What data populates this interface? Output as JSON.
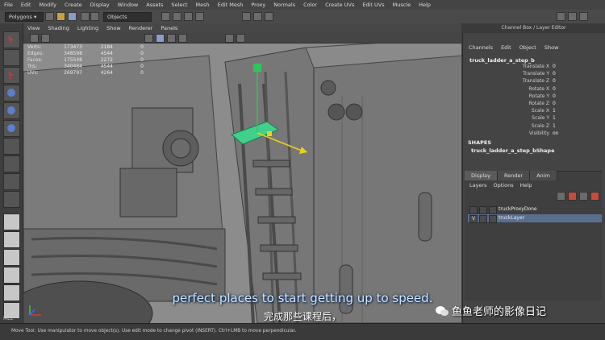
{
  "menu": [
    "File",
    "Edit",
    "Modify",
    "Create",
    "Display",
    "Window",
    "Assets",
    "Select",
    "Mesh",
    "Edit Mesh",
    "Proxy",
    "Normals",
    "Color",
    "Create UVs",
    "Edit UVs",
    "Muscle",
    "Help"
  ],
  "status": {
    "mode": "Polygons",
    "objects_label": "Objects"
  },
  "viewport": {
    "menu": [
      "View",
      "Shading",
      "Lighting",
      "Show",
      "Renderer",
      "Panels"
    ],
    "hud": [
      {
        "label": "Verts:",
        "a": "173473",
        "b": "2184",
        "c": "0"
      },
      {
        "label": "Edges:",
        "a": "348598",
        "b": "4544",
        "c": "0"
      },
      {
        "label": "Faces:",
        "a": "175548",
        "b": "2272",
        "c": "0"
      },
      {
        "label": "Tris:",
        "a": "340484",
        "b": "4544",
        "c": "0"
      },
      {
        "label": "UVs:",
        "a": "269797",
        "b": "4264",
        "c": "0"
      }
    ]
  },
  "channel_box": {
    "title": "Channel Box / Layer Editor",
    "menu": [
      "Channels",
      "Edit",
      "Object",
      "Show"
    ],
    "object_name": "truck_ladder_a_step_b",
    "attributes": [
      {
        "name": "Translate X",
        "value": "0"
      },
      {
        "name": "Translate Y",
        "value": "0"
      },
      {
        "name": "Translate Z",
        "value": "0"
      },
      {
        "name": "Rotate X",
        "value": "0"
      },
      {
        "name": "Rotate Y",
        "value": "0"
      },
      {
        "name": "Rotate Z",
        "value": "0"
      },
      {
        "name": "Scale X",
        "value": "1"
      },
      {
        "name": "Scale Y",
        "value": "1"
      },
      {
        "name": "Scale Z",
        "value": "1"
      },
      {
        "name": "Visibility",
        "value": "on"
      }
    ],
    "shapes_label": "SHAPES",
    "shape_name": "truck_ladder_a_step_bShape"
  },
  "layer_editor": {
    "tabs": [
      "Display",
      "Render",
      "Anim"
    ],
    "menu": [
      "Layers",
      "Options",
      "Help"
    ],
    "layers": [
      {
        "name": "truckProxyDone",
        "visible": ""
      },
      {
        "name": "truckLayer",
        "visible": "V"
      }
    ]
  },
  "subtitles": {
    "english": "perfect places to start getting up to speed.",
    "chinese": "完成那些课程后，"
  },
  "watermark": "鱼鱼老师的影像日记",
  "command_line": {
    "label": "MEL"
  },
  "help_line": "Move Tool: Use manipulator to move object(s). Use edit mode to change pivot (INSERT). Ctrl+LMB to move perpendicular.",
  "colors": {
    "selection": "#41d08a",
    "manipulator": "#e8d21a",
    "viewport_bg": "#8a8a8a"
  }
}
